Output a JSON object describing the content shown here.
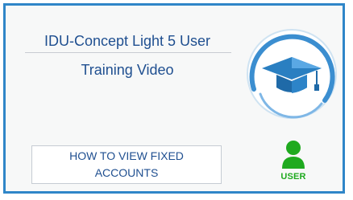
{
  "card": {
    "title_line1": "IDU-Concept Light 5 User",
    "title_line2": "Training Video",
    "subtitle": "HOW TO VIEW FIXED ACCOUNTS"
  },
  "logo": {
    "icon": "graduation-cap-icon"
  },
  "user_badge": {
    "icon": "user-icon",
    "label": "USER"
  },
  "colors": {
    "border": "#2f86c8",
    "title": "#1f4f90",
    "user_green": "#1faa1f"
  }
}
